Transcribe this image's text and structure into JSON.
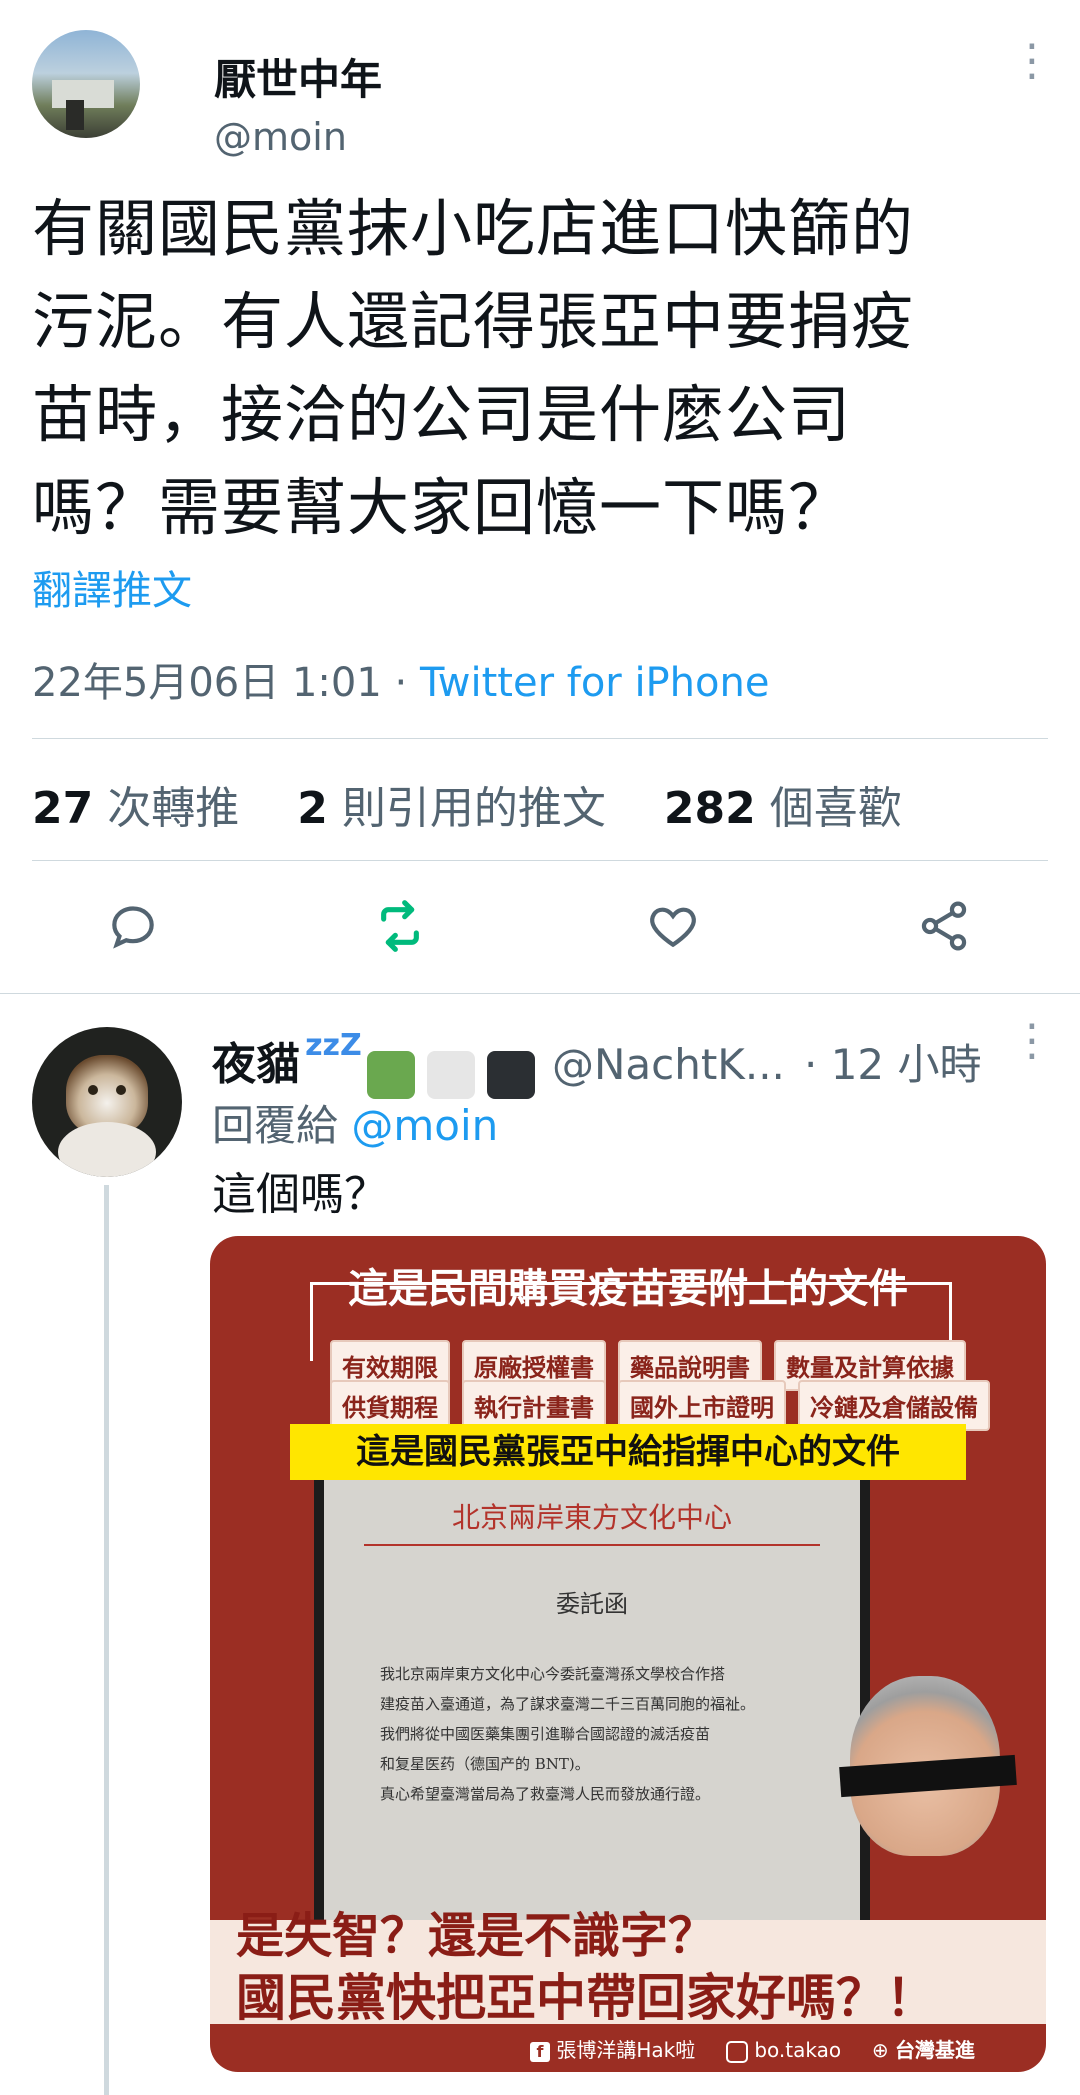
{
  "tweet": {
    "author_name": "厭世中年",
    "author_handle": "@moin",
    "text_lines": [
      "有關國民黨抹小吃店進口快篩的",
      "污泥。有人還記得張亞中要捐疫",
      "苗時，接洽的公司是什麼公司",
      "嗎？需要幫大家回憶一下嗎？"
    ],
    "translate_label": "翻譯推文",
    "date": "22年5月06日 1:01",
    "separator": "·",
    "source": "Twitter for iPhone",
    "stats": {
      "retweets_count": "27",
      "retweets_label": "次轉推",
      "quotes_count": "2",
      "quotes_label": "則引用的推文",
      "likes_count": "282",
      "likes_label": "個喜歡"
    }
  },
  "reply": {
    "author_name": "夜貓",
    "zzz": "zzZ",
    "author_handle": "@NachtK...",
    "time": "· 12 小時",
    "replying_prefix": "回覆給",
    "replying_handle": "@moin",
    "text": "這個嗎？",
    "square_colors": [
      "#6aa84f",
      "#e6e6e6",
      "#2b2f33"
    ]
  },
  "image": {
    "header": "這是民間購買疫苗要附上的文件",
    "docs_row1": [
      "有效期限",
      "原廠授權書",
      "藥品說明書",
      "數量及計算依據"
    ],
    "docs_row2": [
      "供貨期程",
      "執行計畫書",
      "國外上市證明",
      "冷鏈及倉儲設備"
    ],
    "banner": "這是國民黨張亞中給指揮中心的文件",
    "letter_org": "北京兩岸東方文化中心",
    "letter_title": "委託函",
    "letter_lines": [
      "我北京兩岸東方文化中心今委託臺灣孫文學校合作搭",
      "建疫苗入臺通道，為了謀求臺灣二千三百萬同胞的福祉。",
      "我們將從中國医藥集團引進聯合國認證的滅活疫苗",
      "和复星医药（德国产的 BNT)。",
      "真心希望臺灣當局為了救臺灣人民而發放通行證。"
    ],
    "bottom_line1": "是失智？還是不識字？",
    "bottom_line2": "國民黨快把亞中帶回家好嗎？！",
    "footer": [
      "張博洋講Hak啦",
      "bo.takao",
      "台灣基進"
    ]
  },
  "colors": {
    "accent_blue": "#1d9bf0",
    "retweet_green": "#00ba7c",
    "image_red": "#9b2e23",
    "banner_yellow": "#ffe600"
  }
}
